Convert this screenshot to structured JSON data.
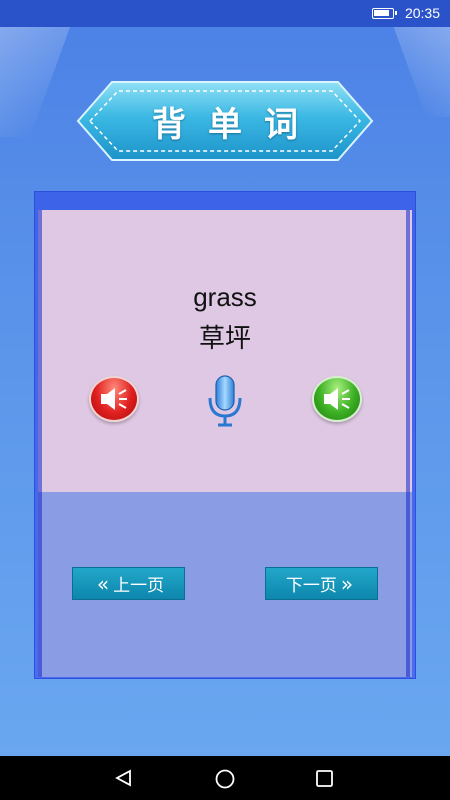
{
  "status_bar": {
    "time": "20:35",
    "battery_icon": "battery-icon"
  },
  "header": {
    "title": "背单词"
  },
  "card": {
    "word": "grass",
    "meaning": "草坪",
    "icons": [
      "speaker-red-icon",
      "microphone-icon",
      "speaker-green-icon"
    ]
  },
  "navigation": {
    "prev_label": "上一页",
    "next_label": "下一页",
    "prev_icon": "double-chevron-left-icon",
    "next_icon": "double-chevron-right-icon"
  },
  "system_nav": {
    "icons": [
      "back-triangle-icon",
      "home-circle-icon",
      "recent-square-icon"
    ]
  },
  "colors": {
    "status_bar": "#2b53c9",
    "card_top": "#dfc8e4",
    "card_bottom": "#8a9ce4",
    "button": "#1497bd",
    "banner": "#29a7d6"
  }
}
